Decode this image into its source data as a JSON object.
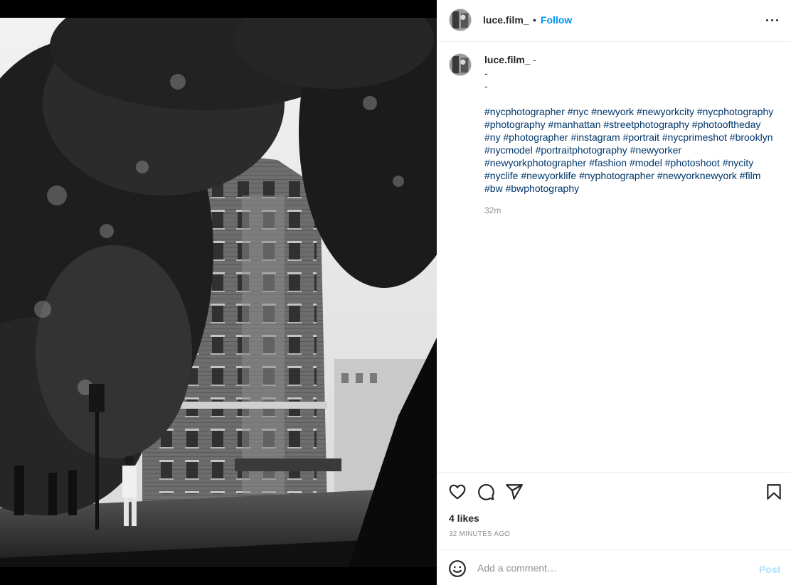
{
  "post": {
    "image_alt": "Black and white photo of a brick apartment building framed by trees on a New York street",
    "author": {
      "username": "luce.film_",
      "follow_label": "Follow",
      "separator": "•"
    },
    "caption": {
      "username": "luce.film_",
      "trailing": "-",
      "lines": [
        "-",
        "-",
        ""
      ],
      "hashtags": [
        "#nycphotographer",
        "#nyc",
        "#newyork",
        "#newyorkcity",
        "#nycphotography",
        "#photography",
        "#manhattan",
        "#streetphotography",
        "#photooftheday",
        "#ny",
        "#photographer",
        "#instagram",
        "#portrait",
        "#nycprimeshot",
        "#brooklyn",
        "#nycmodel",
        "#portraitphotography",
        "#newyorker",
        "#newyorkphotographer",
        "#fashion",
        "#model",
        "#photoshoot",
        "#nycity",
        "#nyclife",
        "#newyorklife",
        "#nyphotographer",
        "#newyorknewyork",
        "#film",
        "#bw",
        "#bwphotography"
      ],
      "time": "32m"
    },
    "likes": "4 likes",
    "posted_ago": "32 MINUTES AGO",
    "comment": {
      "placeholder": "Add a comment…",
      "post_label": "Post"
    }
  },
  "icons": {
    "more": "more-options-icon",
    "like": "heart-icon",
    "comment": "comment-bubble-icon",
    "share": "paper-plane-icon",
    "save": "bookmark-icon",
    "emoji": "smiley-icon"
  },
  "colors": {
    "link_blue": "#0095f6",
    "hashtag": "#00376b",
    "muted": "#8e8e8e",
    "text": "#262626",
    "post_disabled": "#b2dffc"
  }
}
